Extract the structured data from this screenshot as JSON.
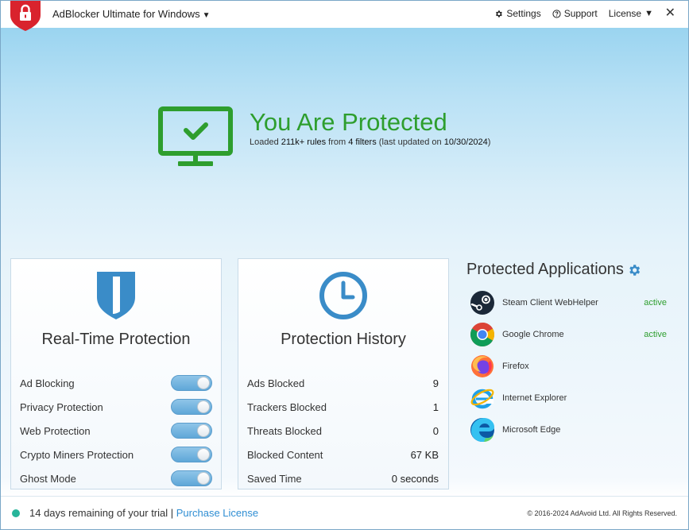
{
  "titlebar": {
    "app_title": "AdBlocker Ultimate for Windows",
    "title_caret": "▼",
    "settings_label": "Settings",
    "support_label": "Support",
    "license_label": "License",
    "license_caret": "▼",
    "close_glyph": "✕"
  },
  "hero": {
    "title": "You Are Protected",
    "sub_loaded": "Loaded ",
    "rules_count": "211k+ rules",
    "sub_from": " from ",
    "filters_count": "4 filters",
    "sub_updated": " (last updated on ",
    "updated_date": "10/30/2024",
    "sub_close": ")"
  },
  "realtime": {
    "title": "Real-Time Protection",
    "toggles": [
      {
        "label": "Ad Blocking",
        "on": true
      },
      {
        "label": "Privacy Protection",
        "on": true
      },
      {
        "label": "Web Protection",
        "on": true
      },
      {
        "label": "Crypto Miners Protection",
        "on": true
      },
      {
        "label": "Ghost Mode",
        "on": true
      }
    ]
  },
  "history": {
    "title": "Protection History",
    "stats": [
      {
        "label": "Ads Blocked",
        "value": "9"
      },
      {
        "label": "Trackers Blocked",
        "value": "1"
      },
      {
        "label": "Threats Blocked",
        "value": "0"
      },
      {
        "label": "Blocked Content",
        "value": "67 KB"
      },
      {
        "label": "Saved Time",
        "value": "0 seconds"
      }
    ]
  },
  "apps": {
    "title": "Protected Applications",
    "items": [
      {
        "name": "Steam Client WebHelper",
        "status": "active",
        "icon": "steam-icon"
      },
      {
        "name": "Google Chrome",
        "status": "active",
        "icon": "chrome-icon"
      },
      {
        "name": "Firefox",
        "status": "",
        "icon": "firefox-icon"
      },
      {
        "name": "Internet Explorer",
        "status": "",
        "icon": "ie-icon"
      },
      {
        "name": "Microsoft Edge",
        "status": "",
        "icon": "edge-icon"
      }
    ]
  },
  "footer": {
    "trial_text": "14 days remaining of your trial",
    "separator": " | ",
    "purchase_label": "Purchase License",
    "copyright": "© 2016-2024 AdAvoid Ltd. All Rights Reserved."
  },
  "colors": {
    "accent_green": "#2e9e2e",
    "accent_blue": "#3a8cc8",
    "brand_red": "#d9232d",
    "link_blue": "#2f8ed3"
  }
}
